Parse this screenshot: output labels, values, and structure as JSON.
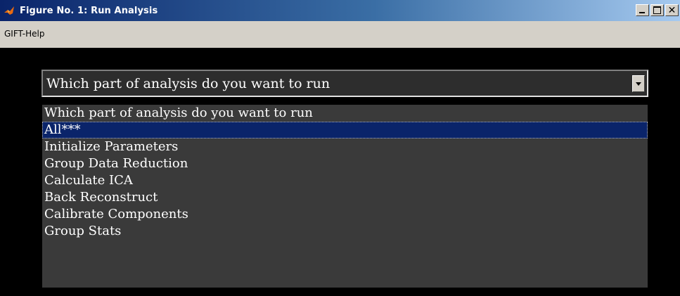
{
  "window": {
    "title": "Figure No. 1: Run Analysis",
    "icon": "matlab-logo-icon"
  },
  "title_buttons": {
    "minimize_icon": "minimize-icon",
    "maximize_icon": "maximize-icon",
    "close_glyph": "✕"
  },
  "menu": {
    "items": [
      "GIFT-Help"
    ]
  },
  "popup": {
    "selected_value": "Which part of analysis do you want to run",
    "arrow_icon": "chevron-down-icon",
    "options": [
      "Which part of analysis do you want to run",
      "All***",
      "Initialize Parameters",
      "Group Data Reduction",
      "Calculate ICA",
      "Back Reconstruct",
      "Calibrate Components",
      "Group Stats"
    ],
    "highlighted_index": 1
  },
  "colors": {
    "figure_background": "#000000",
    "listbox_background": "#3a3a3a",
    "highlight": "#0a246a",
    "title_gradient_start": "#0a246a",
    "title_gradient_end": "#a6caf0"
  }
}
